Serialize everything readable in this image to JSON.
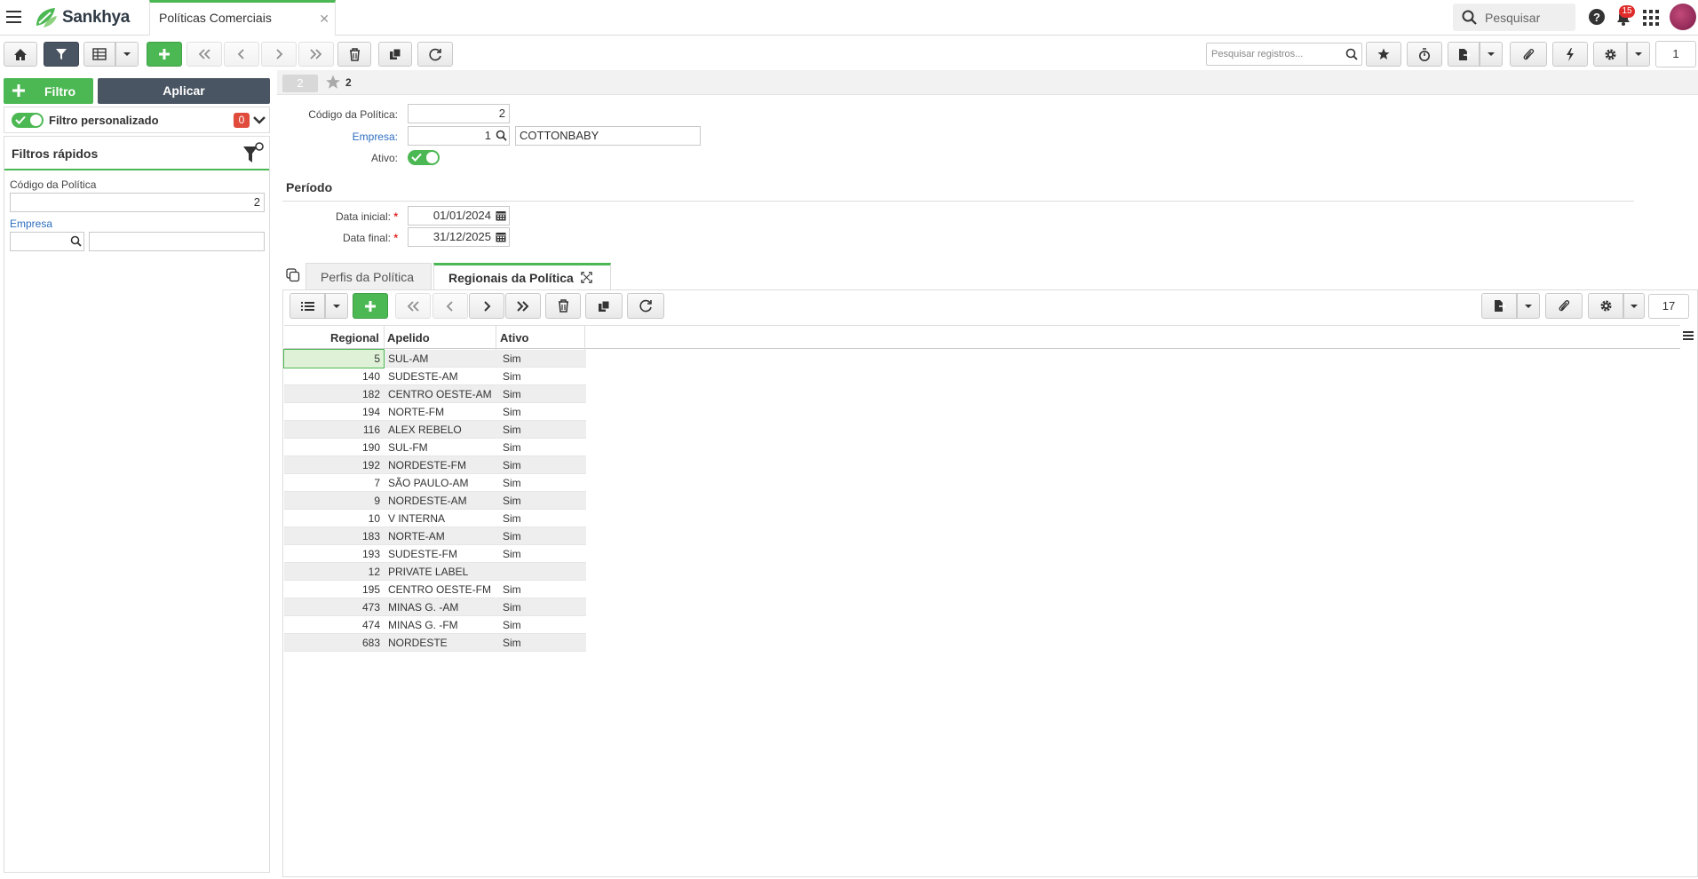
{
  "header": {
    "brand": "Sankhya",
    "tab_title": "Políticas Comerciais",
    "search_placeholder": "Pesquisar",
    "notification_count": "15"
  },
  "toolbar": {
    "search_placeholder": "Pesquisar registros...",
    "page_number": "1"
  },
  "left_panel": {
    "filter_button": "Filtro",
    "apply_button": "Aplicar",
    "custom_filter_label": "Filtro personalizado",
    "custom_filter_count": "0",
    "quick_filters_title": "Filtros rápidos",
    "codigo_label": "Código da Política",
    "codigo_value": "2",
    "empresa_label": "Empresa",
    "empresa_value": "",
    "empresa_name": ""
  },
  "record": {
    "tab_number": "2",
    "favorite_number": "2"
  },
  "form": {
    "codigo_label": "Código da Política:",
    "codigo_value": "2",
    "empresa_label": "Empresa:",
    "empresa_code": "1",
    "empresa_name": "COTTONBABY",
    "ativo_label": "Ativo:",
    "periodo_title": "Período",
    "data_inicial_label": "Data inicial:",
    "data_inicial_value": "01/01/2024",
    "data_final_label": "Data final:",
    "data_final_value": "31/12/2025"
  },
  "detail_tabs": [
    {
      "label": "Perfis da Política"
    },
    {
      "label": "Regionais da Política"
    }
  ],
  "detail_toolbar": {
    "record_count": "17"
  },
  "grid": {
    "columns": [
      "Regional",
      "Apelido",
      "Ativo"
    ],
    "rows": [
      {
        "regional": "5",
        "apelido": "SUL-AM",
        "ativo": "Sim"
      },
      {
        "regional": "140",
        "apelido": "SUDESTE-AM",
        "ativo": "Sim"
      },
      {
        "regional": "182",
        "apelido": "CENTRO OESTE-AM",
        "ativo": "Sim"
      },
      {
        "regional": "194",
        "apelido": "NORTE-FM",
        "ativo": "Sim"
      },
      {
        "regional": "116",
        "apelido": "ALEX REBELO",
        "ativo": "Sim"
      },
      {
        "regional": "190",
        "apelido": "SUL-FM",
        "ativo": "Sim"
      },
      {
        "regional": "192",
        "apelido": "NORDESTE-FM",
        "ativo": "Sim"
      },
      {
        "regional": "7",
        "apelido": "SÃO PAULO-AM",
        "ativo": "Sim"
      },
      {
        "regional": "9",
        "apelido": "NORDESTE-AM",
        "ativo": "Sim"
      },
      {
        "regional": "10",
        "apelido": "V INTERNA",
        "ativo": "Sim"
      },
      {
        "regional": "183",
        "apelido": "NORTE-AM",
        "ativo": "Sim"
      },
      {
        "regional": "193",
        "apelido": "SUDESTE-FM",
        "ativo": "Sim"
      },
      {
        "regional": "12",
        "apelido": "PRIVATE LABEL",
        "ativo": ""
      },
      {
        "regional": "195",
        "apelido": "CENTRO OESTE-FM",
        "ativo": "Sim"
      },
      {
        "regional": "473",
        "apelido": "MINAS G. -AM",
        "ativo": "Sim"
      },
      {
        "regional": "474",
        "apelido": "MINAS G. -FM",
        "ativo": "Sim"
      },
      {
        "regional": "683",
        "apelido": "NORDESTE",
        "ativo": "Sim"
      }
    ]
  },
  "colors": {
    "accent_green": "#4cb853",
    "dark_button": "#4a5563",
    "link_blue": "#2c6ebf",
    "badge_red": "#e02b2b"
  }
}
